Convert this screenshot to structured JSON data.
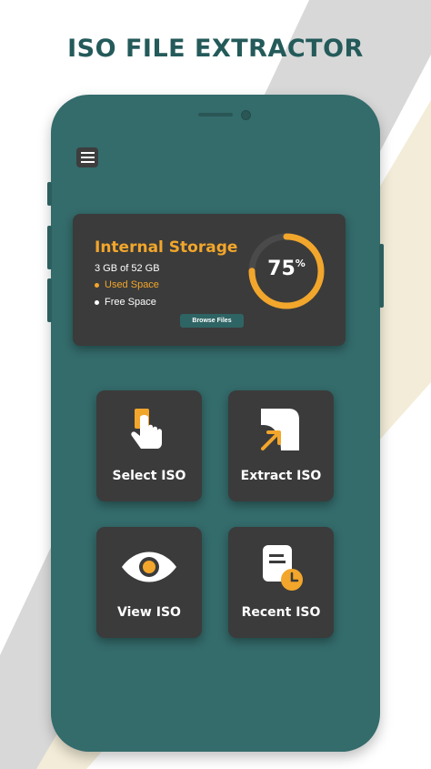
{
  "headline": "ISO FILE EXTRACTOR",
  "colors": {
    "accent": "#f2a62b",
    "phone_body": "#346b6b",
    "card": "#3b3b3b",
    "headline": "#245a5a"
  },
  "menu": {
    "icon": "hamburger-icon"
  },
  "storage": {
    "title": "Internal Storage",
    "amount": "3 GB of 52 GB",
    "used_label": "Used Space",
    "free_label": "Free Space",
    "browse_label": "Browse Files",
    "used_percent": 75,
    "percent_value": "75",
    "percent_sign": "%"
  },
  "tiles": [
    {
      "label": "Select ISO",
      "icon": "tap-finger-icon"
    },
    {
      "label": "Extract ISO",
      "icon": "extract-arrow-icon"
    },
    {
      "label": "View ISO",
      "icon": "eye-icon"
    },
    {
      "label": "Recent ISO",
      "icon": "recent-file-clock-icon"
    }
  ]
}
